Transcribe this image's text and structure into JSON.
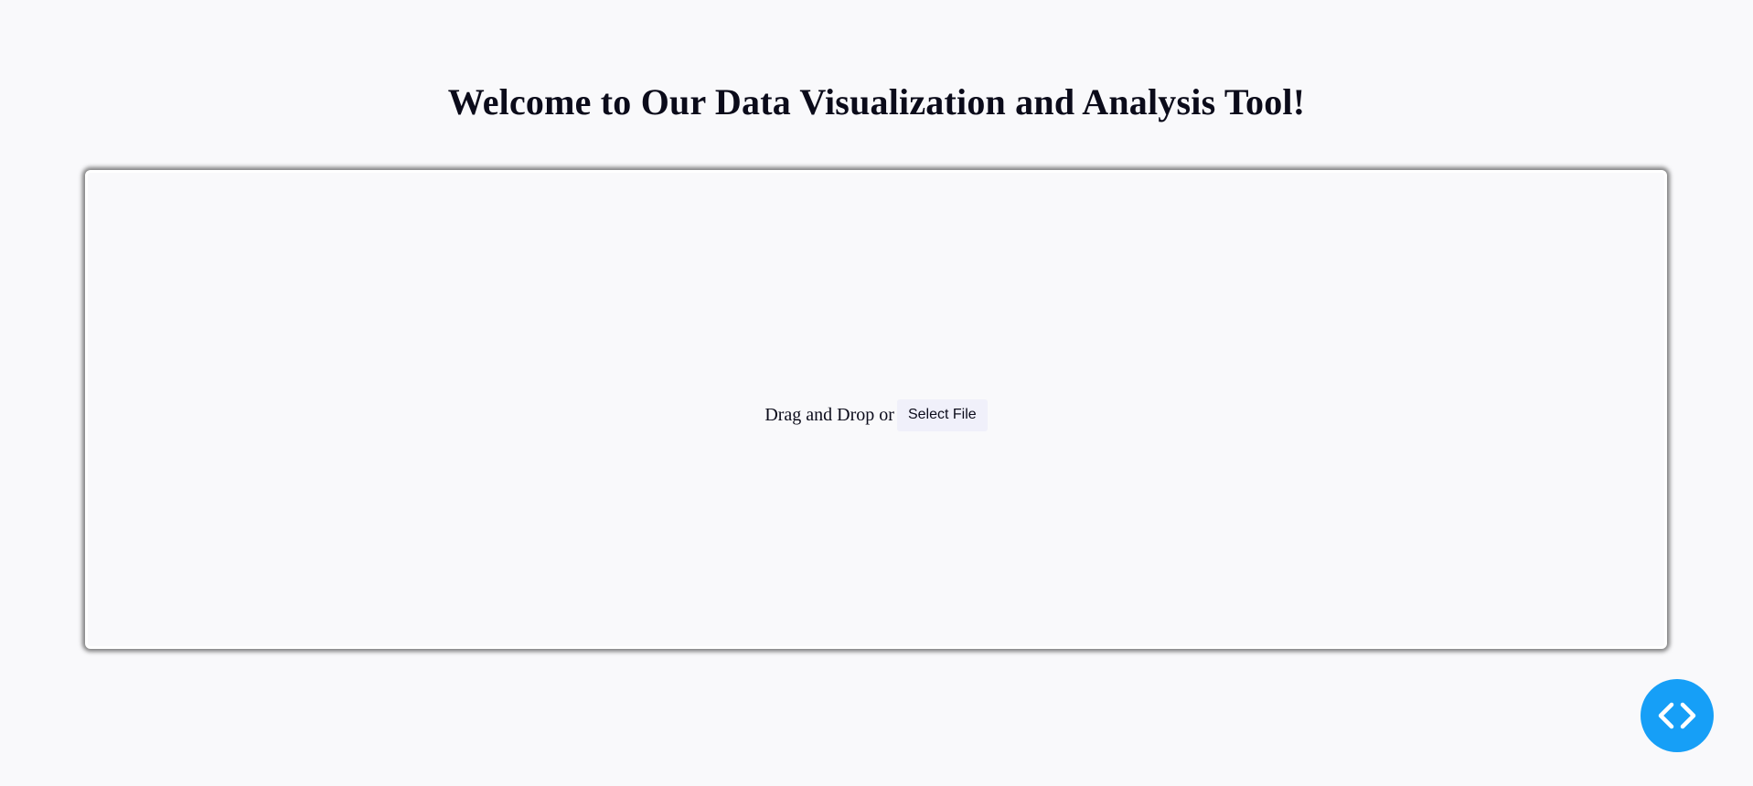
{
  "header": {
    "title": "Welcome to Our Data Visualization and Analysis Tool!"
  },
  "upload": {
    "prompt": "Drag and Drop or",
    "button_label": "Select File"
  },
  "fab": {
    "icon": "code-icon",
    "color": "#169ff7"
  },
  "colors": {
    "background": "#f9f9fb",
    "button_background": "#f0f0fa",
    "accent": "#169ff7"
  }
}
